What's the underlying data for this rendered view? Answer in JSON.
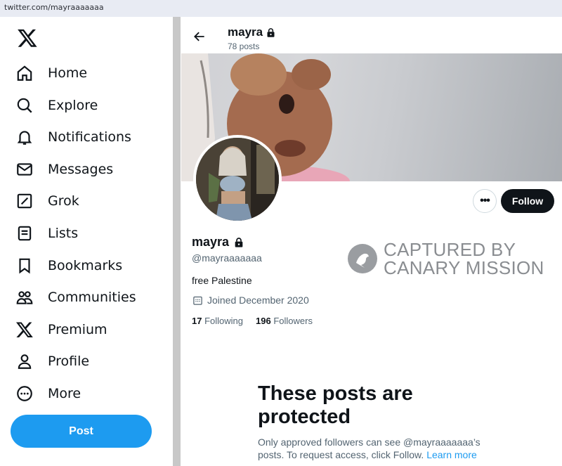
{
  "browser": {
    "url": "twitter.com/mayraaaaaaa"
  },
  "sidebar": {
    "logo_icon": "x-logo-icon",
    "items": [
      {
        "label": "Home",
        "icon": "home-icon"
      },
      {
        "label": "Explore",
        "icon": "search-icon"
      },
      {
        "label": "Notifications",
        "icon": "bell-icon"
      },
      {
        "label": "Messages",
        "icon": "envelope-icon"
      },
      {
        "label": "Grok",
        "icon": "grok-icon"
      },
      {
        "label": "Lists",
        "icon": "list-icon"
      },
      {
        "label": "Bookmarks",
        "icon": "bookmark-icon"
      },
      {
        "label": "Communities",
        "icon": "communities-icon"
      },
      {
        "label": "Premium",
        "icon": "x-logo-icon"
      },
      {
        "label": "Profile",
        "icon": "person-icon"
      },
      {
        "label": "More",
        "icon": "more-circle-icon"
      }
    ],
    "post_button": "Post"
  },
  "header": {
    "name": "mayra",
    "post_count": "78 posts"
  },
  "profile": {
    "name": "mayra",
    "handle": "@mayraaaaaaa",
    "bio": "free Palestine",
    "joined": "Joined December 2020",
    "following_count": "17",
    "following_label": "Following",
    "followers_count": "196",
    "followers_label": "Followers",
    "follow_button": "Follow",
    "more_button": "•••"
  },
  "watermark": {
    "line1": "CAPTURED BY",
    "line2": "CANARY MISSION"
  },
  "protected": {
    "title": "These posts are protected",
    "description": "Only approved followers can see @mayraaaaaaa’s posts. To request access, click Follow.",
    "link": "Learn more"
  },
  "colors": {
    "accent": "#1d9bf0",
    "text": "#0f1419",
    "muted": "#536471",
    "follow_bg": "#0f1419"
  }
}
